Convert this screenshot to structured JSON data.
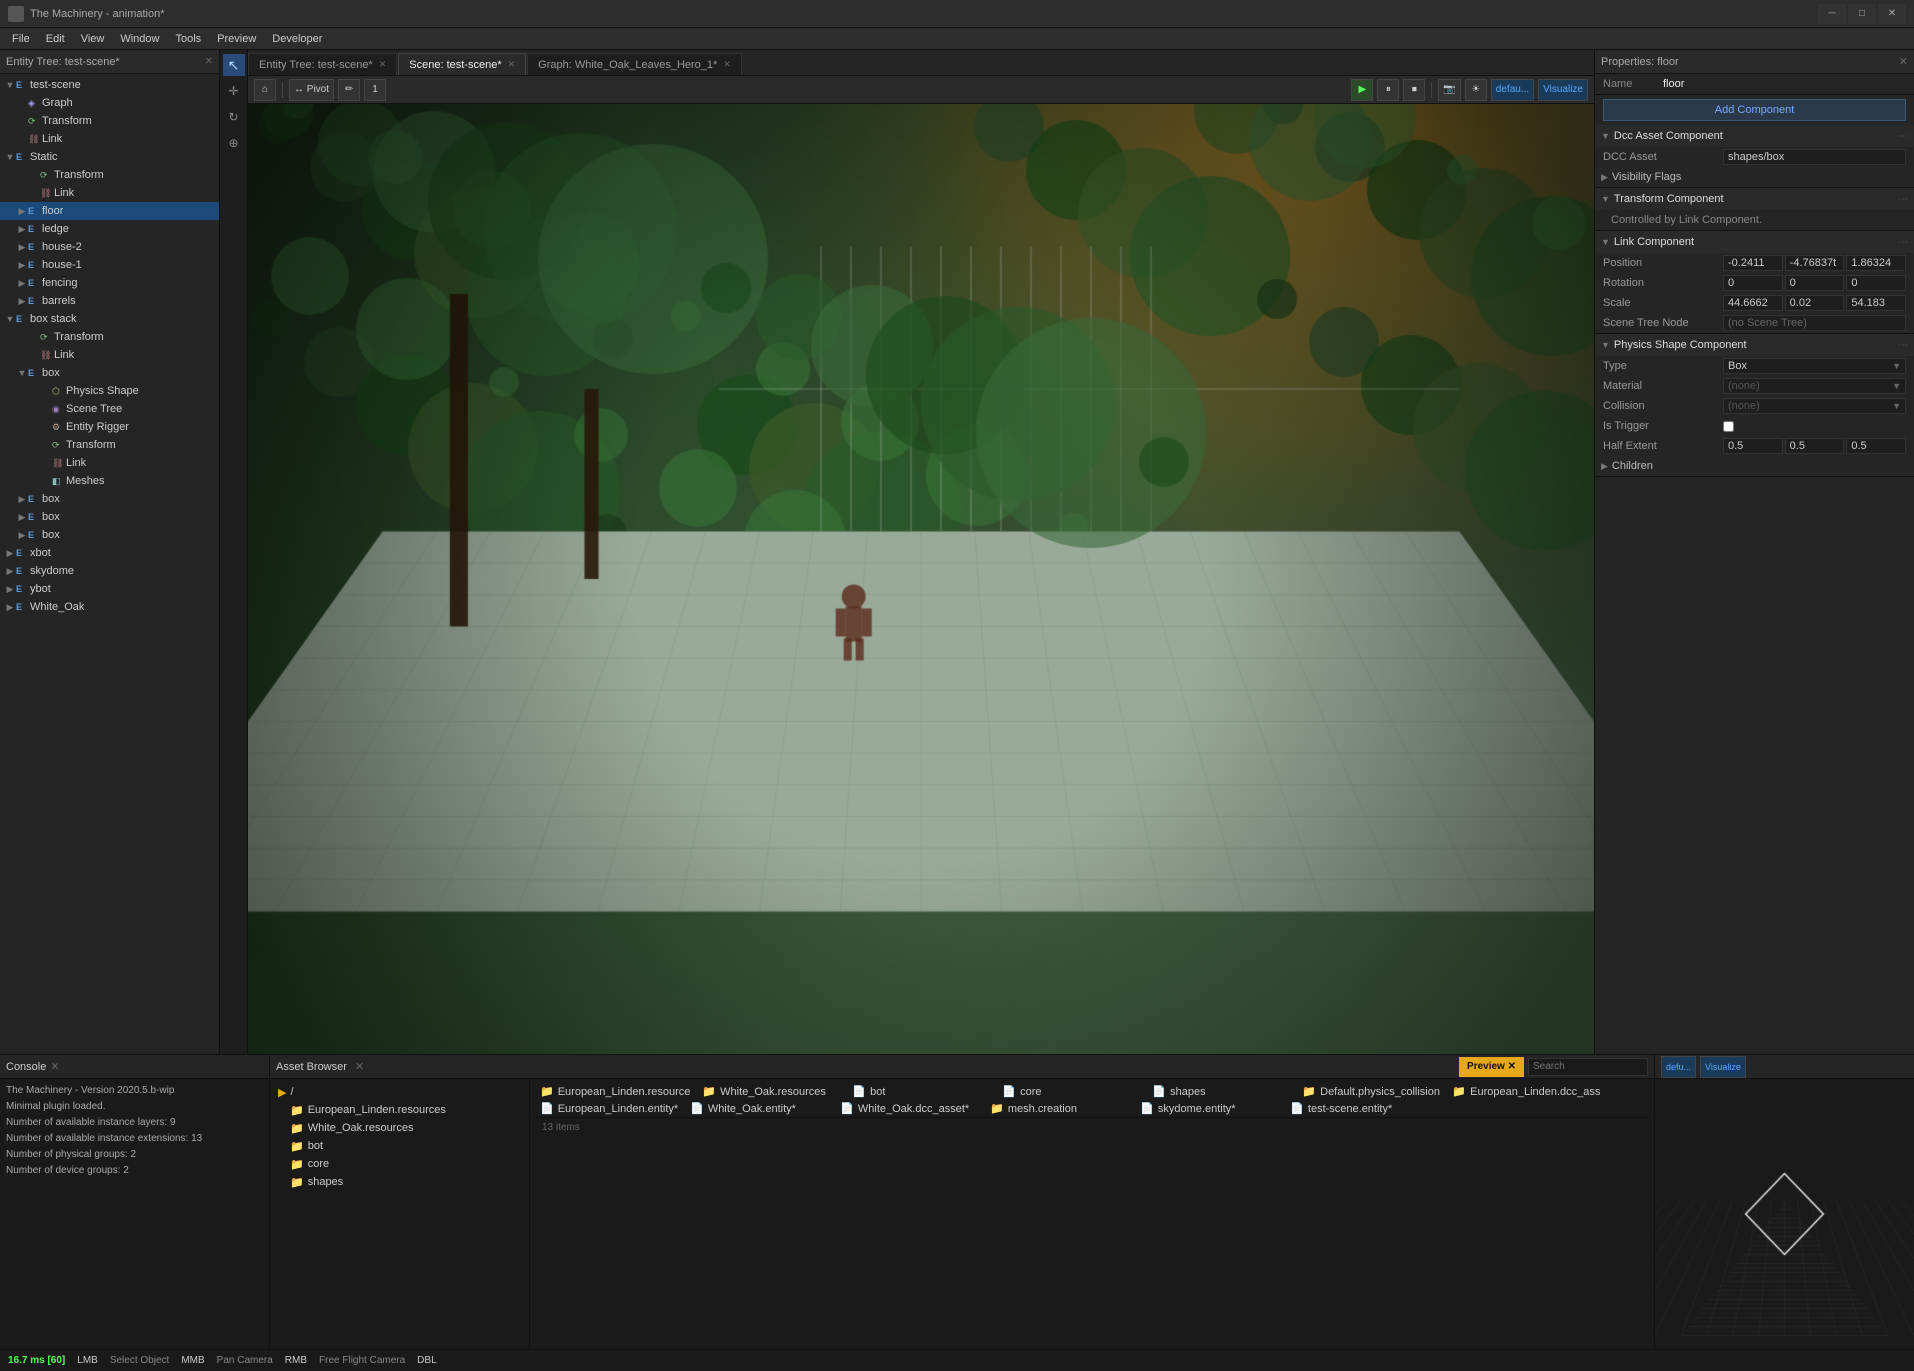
{
  "app": {
    "title": "The Machinery - animation*",
    "icon": "TM"
  },
  "menu": {
    "items": [
      "File",
      "Edit",
      "View",
      "Window",
      "Tools",
      "Preview",
      "Developer"
    ]
  },
  "tabs": [
    {
      "label": "Entity Tree: test-scene*",
      "active": false,
      "closeable": true
    },
    {
      "label": "Scene: test-scene*",
      "active": true,
      "closeable": true
    },
    {
      "label": "Graph: White_Oak_Leaves_Hero_1*",
      "active": false,
      "closeable": true
    }
  ],
  "entity_tree": {
    "header": "Entity Tree: test-scene*",
    "items": [
      {
        "id": "test-scene",
        "label": "test-scene",
        "indent": 0,
        "expanded": true,
        "type": "entity",
        "selected": false
      },
      {
        "id": "graph",
        "label": "Graph",
        "indent": 1,
        "type": "graph",
        "selected": false
      },
      {
        "id": "transform-root",
        "label": "Transform",
        "indent": 1,
        "type": "transform",
        "selected": false
      },
      {
        "id": "link-root",
        "label": "Link",
        "indent": 1,
        "type": "link",
        "selected": false
      },
      {
        "id": "static",
        "label": "Static",
        "indent": 1,
        "expanded": true,
        "type": "entity",
        "selected": false
      },
      {
        "id": "transform-static",
        "label": "Transform",
        "indent": 2,
        "type": "transform",
        "selected": false
      },
      {
        "id": "link-static",
        "label": "Link",
        "indent": 2,
        "type": "link",
        "selected": false
      },
      {
        "id": "floor",
        "label": "floor",
        "indent": 2,
        "type": "entity",
        "selected": true,
        "expanded": false
      },
      {
        "id": "ledge",
        "label": "ledge",
        "indent": 2,
        "type": "entity",
        "selected": false
      },
      {
        "id": "house-2",
        "label": "house-2",
        "indent": 2,
        "type": "entity",
        "selected": false
      },
      {
        "id": "house-1",
        "label": "house-1",
        "indent": 2,
        "type": "entity",
        "selected": false
      },
      {
        "id": "fencing",
        "label": "fencing",
        "indent": 2,
        "type": "entity",
        "selected": false
      },
      {
        "id": "barrels",
        "label": "barrels",
        "indent": 2,
        "type": "entity",
        "selected": false
      },
      {
        "id": "box-stack",
        "label": "box stack",
        "indent": 2,
        "expanded": true,
        "type": "entity",
        "selected": false
      },
      {
        "id": "transform-bs",
        "label": "Transform",
        "indent": 3,
        "type": "transform",
        "selected": false
      },
      {
        "id": "link-bs",
        "label": "Link",
        "indent": 3,
        "type": "link",
        "selected": false
      },
      {
        "id": "box-main",
        "label": "box",
        "indent": 3,
        "expanded": true,
        "type": "entity",
        "selected": false
      },
      {
        "id": "physics-shape",
        "label": "Physics Shape",
        "indent": 4,
        "type": "physics",
        "selected": false
      },
      {
        "id": "scene-tree",
        "label": "Scene Tree",
        "indent": 4,
        "type": "scene",
        "selected": false
      },
      {
        "id": "entity-rigger",
        "label": "Entity Rigger",
        "indent": 4,
        "type": "rigger",
        "selected": false
      },
      {
        "id": "transform-box",
        "label": "Transform",
        "indent": 4,
        "type": "transform",
        "selected": false
      },
      {
        "id": "link-box",
        "label": "Link",
        "indent": 4,
        "type": "link",
        "selected": false
      },
      {
        "id": "meshes",
        "label": "Meshes",
        "indent": 4,
        "type": "mesh",
        "selected": false
      },
      {
        "id": "box2",
        "label": "box",
        "indent": 3,
        "type": "entity",
        "selected": false
      },
      {
        "id": "box3",
        "label": "box",
        "indent": 3,
        "type": "entity",
        "selected": false
      },
      {
        "id": "box4",
        "label": "box",
        "indent": 3,
        "type": "entity",
        "selected": false
      },
      {
        "id": "xbot",
        "label": "xbot",
        "indent": 1,
        "type": "entity",
        "selected": false
      },
      {
        "id": "skydome",
        "label": "skydome",
        "indent": 1,
        "type": "entity",
        "selected": false
      },
      {
        "id": "ybot",
        "label": "ybot",
        "indent": 1,
        "type": "entity",
        "selected": false
      },
      {
        "id": "white-oak",
        "label": "White_Oak",
        "indent": 1,
        "type": "entity",
        "selected": false
      }
    ]
  },
  "viewport": {
    "pivot_label": "↔ Pivot",
    "brush_label": "✏",
    "number_label": "1",
    "default_label": "defau...",
    "visualize_label": "Visualize"
  },
  "properties": {
    "header": "Properties: floor",
    "name_label": "Name",
    "name_value": "floor",
    "add_component": "Add Component",
    "sections": [
      {
        "id": "dcc-asset",
        "title": "Dcc Asset Component",
        "expanded": true,
        "fields": [
          {
            "label": "DCC Asset",
            "value": "shapes/box",
            "type": "text"
          },
          {
            "label": "Visibility Flags",
            "value": "",
            "type": "subheader"
          }
        ]
      },
      {
        "id": "transform",
        "title": "Transform Component",
        "expanded": true,
        "note": "Controlled by Link Component.",
        "fields": []
      },
      {
        "id": "link",
        "title": "Link Component",
        "expanded": true,
        "fields": [
          {
            "label": "Position",
            "values": [
              "-0.2411",
              "-4.76837t",
              "1.86324"
            ],
            "type": "triple"
          },
          {
            "label": "Rotation",
            "values": [
              "0",
              "0",
              "0"
            ],
            "type": "triple"
          },
          {
            "label": "Scale",
            "values": [
              "44.6662",
              "0.02",
              "54.183"
            ],
            "type": "triple"
          },
          {
            "label": "Scene Tree Node",
            "value": "(no Scene Tree)",
            "type": "text"
          }
        ]
      },
      {
        "id": "physics-shape",
        "title": "Physics Shape Component",
        "expanded": true,
        "fields": [
          {
            "label": "Type",
            "value": "Box",
            "type": "dropdown"
          },
          {
            "label": "Material",
            "value": "(none)",
            "type": "dropdown"
          },
          {
            "label": "Collision",
            "value": "(none)",
            "type": "dropdown"
          },
          {
            "label": "Is Trigger",
            "value": "",
            "type": "checkbox"
          },
          {
            "label": "Half Extent",
            "values": [
              "0.5",
              "0.5",
              "0.5"
            ],
            "type": "triple"
          },
          {
            "label": "Children",
            "value": "",
            "type": "subheader"
          }
        ]
      }
    ]
  },
  "console": {
    "header": "Console",
    "lines": [
      {
        "text": "The Machinery - Version 2020.5.b-wip",
        "type": "normal"
      },
      {
        "text": "Minimal plugin loaded.",
        "type": "normal"
      },
      {
        "text": "Number of available instance layers: 9",
        "type": "normal"
      },
      {
        "text": "Number of available instance extensions: 13",
        "type": "normal"
      },
      {
        "text": "Number of physical groups: 2",
        "type": "normal"
      },
      {
        "text": "Number of device groups: 2",
        "type": "normal"
      }
    ]
  },
  "asset_browser": {
    "header": "Asset Browser",
    "search_placeholder": "Search",
    "preview_label": "Preview",
    "items_count": "13 items",
    "root": "/",
    "tree_items": [
      {
        "label": "European_Linden.resources",
        "indent": 1
      },
      {
        "label": "White_Oak.resources",
        "indent": 1
      },
      {
        "label": "bot",
        "indent": 1
      },
      {
        "label": "core",
        "indent": 1
      },
      {
        "label": "shapes",
        "indent": 1
      }
    ],
    "grid_items": [
      {
        "label": "European_Linden.resource",
        "icon": "folder"
      },
      {
        "label": "Default.physics_collision",
        "icon": "folder"
      },
      {
        "label": "White_Oak.resources",
        "icon": "folder"
      },
      {
        "label": "European_Linden.dcc_ass",
        "icon": "folder"
      },
      {
        "label": "skydome.entity*",
        "icon": "file"
      },
      {
        "label": "bot",
        "icon": "folder"
      },
      {
        "label": "European_Linden.entity*",
        "icon": "file"
      },
      {
        "label": "test-scene.entity*",
        "icon": "file"
      },
      {
        "label": "core",
        "icon": "folder"
      },
      {
        "label": "White_Oak.entity*",
        "icon": "file"
      },
      {
        "label": "shapes",
        "icon": "folder"
      },
      {
        "label": "White_Oak.dcc_asset*",
        "icon": "file"
      },
      {
        "label": "mesh.creation",
        "icon": "folder"
      }
    ]
  },
  "statusbar": {
    "fps": "16.7 ms [60]",
    "lmb": "LMB",
    "lmb_action": "Select Object",
    "mmb": "MMB",
    "mmb_action": "Pan Camera",
    "rmb": "RMB",
    "rmb_action": "Free Flight Camera",
    "dbl": "DBL"
  },
  "mini_viewport": {
    "default_label": "defu...",
    "visualize_label": "Visualize"
  }
}
